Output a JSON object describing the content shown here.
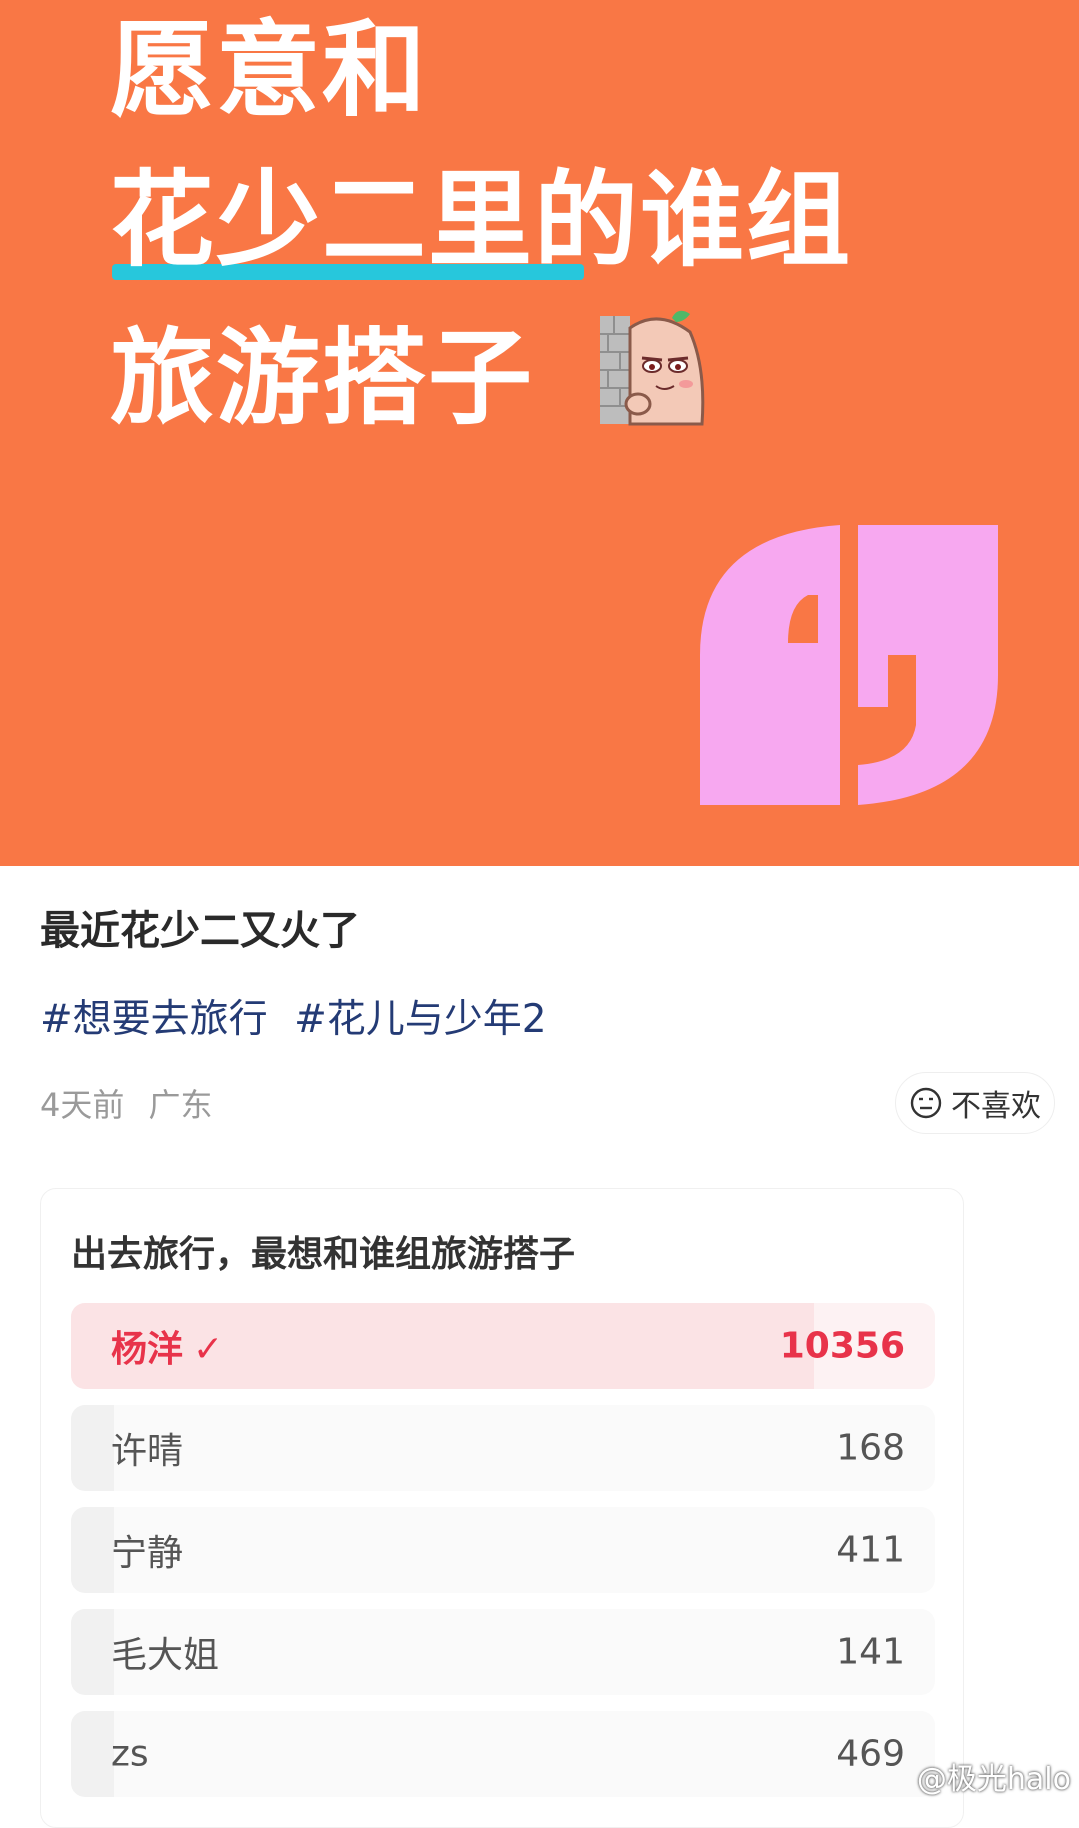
{
  "hero": {
    "line1": "愿意和",
    "line2": "花少二里的谁组",
    "line3": "旅游搭子",
    "sticker_icon": "peeking-sticker-icon",
    "logo_icon": "quote-brand-logo",
    "colors": {
      "background": "#f97745",
      "underline": "#27c7dc",
      "logo": "#f7a8f0"
    }
  },
  "post": {
    "title": "最近花少二又火了",
    "tags": [
      "#想要去旅行",
      "#花儿与少年2"
    ],
    "time": "4天前",
    "location": "广东",
    "dislike_label": "不喜欢",
    "dislike_icon": "neutral-face-icon"
  },
  "poll": {
    "question": "出去旅行，最想和谁组旅游搭子",
    "options": [
      {
        "label": "杨洋",
        "count": "10356",
        "selected": true,
        "fill": 0.86
      },
      {
        "label": "许晴",
        "count": "168",
        "selected": false,
        "fill": 0.05
      },
      {
        "label": "宁静",
        "count": "411",
        "selected": false,
        "fill": 0.05
      },
      {
        "label": "毛大姐",
        "count": "141",
        "selected": false,
        "fill": 0.05
      },
      {
        "label": "zs",
        "count": "469",
        "selected": false,
        "fill": 0.05
      }
    ],
    "check_mark": "✓",
    "accent": "#e8334a"
  },
  "watermark": "@极光halo"
}
